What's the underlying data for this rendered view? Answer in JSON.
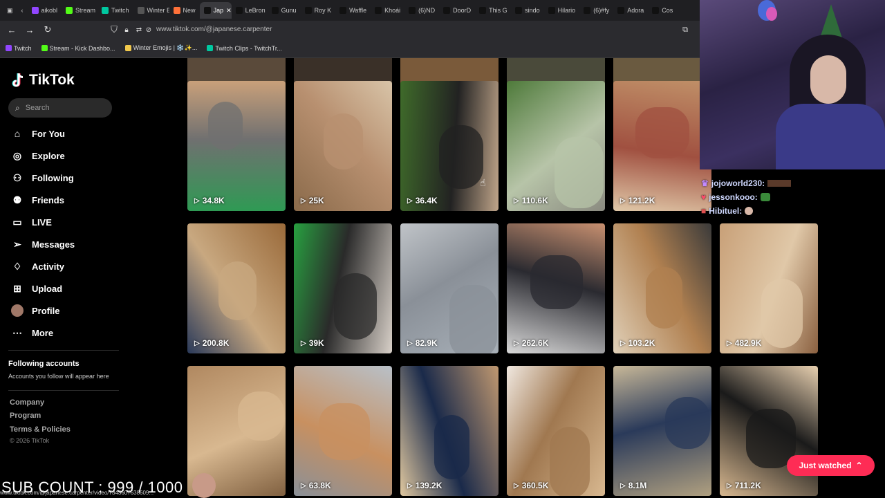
{
  "tabs": [
    {
      "label": "aikobl",
      "color": "#9146ff"
    },
    {
      "label": "Stream",
      "color": "#53fc18"
    },
    {
      "label": "Twitch",
      "color": "#00c8a0"
    },
    {
      "label": "Winter Em",
      "color": "#555"
    },
    {
      "label": "New",
      "color": "#ff7139"
    },
    {
      "label": "Jap",
      "color": "#111",
      "active": true
    },
    {
      "label": "LeBron",
      "color": "#111"
    },
    {
      "label": "Gunu",
      "color": "#111"
    },
    {
      "label": "Roy K",
      "color": "#111"
    },
    {
      "label": "Waffle",
      "color": "#111"
    },
    {
      "label": "Khoái",
      "color": "#111"
    },
    {
      "label": "(6)ND",
      "color": "#111"
    },
    {
      "label": "DoorD",
      "color": "#111"
    },
    {
      "label": "This G",
      "color": "#111"
    },
    {
      "label": "sindo",
      "color": "#111"
    },
    {
      "label": "Hilario",
      "color": "#111"
    },
    {
      "label": "(6)#fy",
      "color": "#111"
    },
    {
      "label": "Adora",
      "color": "#111"
    },
    {
      "label": "Cos",
      "color": "#111"
    }
  ],
  "address": {
    "url": "www.tiktok.com/@japanese.carpenter"
  },
  "bookmarks": [
    {
      "label": "Twitch",
      "color": "#9146ff"
    },
    {
      "label": "Stream - Kick Dashbo...",
      "color": "#53fc18"
    },
    {
      "label": "Winter Emojis | ❄️✨...",
      "color": "#f2c94c"
    },
    {
      "label": "Twitch Clips - TwitchTr...",
      "color": "#00c8a0"
    }
  ],
  "sidebar": {
    "logo": "TikTok",
    "search_placeholder": "Search",
    "items": [
      {
        "label": "For You",
        "icon": "home-icon"
      },
      {
        "label": "Explore",
        "icon": "compass-icon"
      },
      {
        "label": "Following",
        "icon": "user-plus-icon"
      },
      {
        "label": "Friends",
        "icon": "users-icon"
      },
      {
        "label": "LIVE",
        "icon": "live-icon"
      },
      {
        "label": "Messages",
        "icon": "send-icon"
      },
      {
        "label": "Activity",
        "icon": "bell-icon"
      },
      {
        "label": "Upload",
        "icon": "upload-icon"
      },
      {
        "label": "Profile",
        "icon": "avatar"
      },
      {
        "label": "More",
        "icon": "more-icon"
      }
    ],
    "following_title": "Following accounts",
    "following_sub": "Accounts you follow will appear here",
    "footer": [
      "Company",
      "Program",
      "Terms & Policies"
    ],
    "copyright": "© 2026 TikTok"
  },
  "videos": [
    {
      "views": "34.8K",
      "colors": [
        "#2f9a54",
        "#707070",
        "#c9a07a"
      ]
    },
    {
      "views": "25K",
      "colors": [
        "#8a6a4a",
        "#b89070",
        "#d8c4a8"
      ]
    },
    {
      "views": "36.4K",
      "colors": [
        "#3f6b2a",
        "#222",
        "#c0a58a"
      ]
    },
    {
      "views": "110.6K",
      "colors": [
        "#4e7a3a",
        "#b7c4a8",
        "#8a8a80"
      ]
    },
    {
      "views": "121.2K",
      "colors": [
        "#c09068",
        "#a05040",
        "#e0c8a8"
      ]
    },
    {
      "views": "200.8K",
      "colors": [
        "#9a6a3a",
        "#c8a880",
        "#2a3a5a"
      ]
    },
    {
      "views": "39K",
      "colors": [
        "#d8d0c8",
        "#2a2a2a",
        "#28a040"
      ]
    },
    {
      "views": "82.9K",
      "colors": [
        "#a8b0b8",
        "#8a9098",
        "#c0c4c8"
      ]
    },
    {
      "views": "262.6K",
      "colors": [
        "#d8d8d8",
        "#2a2a30",
        "#c89070"
      ]
    },
    {
      "views": "103.2K",
      "colors": [
        "#e0d0b8",
        "#b08050",
        "#3a3a3a"
      ]
    },
    {
      "views": "482.9K",
      "colors": [
        "#c8a078",
        "#e0c8a8",
        "#8a6040"
      ]
    },
    {
      "views": "",
      "colors": [
        "#b08860",
        "#d8b890",
        "#806040"
      ]
    },
    {
      "views": "63.8K",
      "colors": [
        "#b8c0c8",
        "#c89060",
        "#8a9098"
      ]
    },
    {
      "views": "139.2K",
      "colors": [
        "#c09870",
        "#1a2a4a",
        "#e0c8a0"
      ]
    },
    {
      "views": "360.5K",
      "colors": [
        "#d8b890",
        "#a07850",
        "#f0e8e0"
      ]
    },
    {
      "views": "8.1M",
      "colors": [
        "#b0a080",
        "#2a3a5a",
        "#c8b898"
      ]
    },
    {
      "views": "711.2K",
      "colors": [
        "#d8b890",
        "#1a1a1a",
        "#e8d0b0"
      ]
    }
  ],
  "chat": [
    {
      "user": "jojoworld230:"
    },
    {
      "user": "jessonkooo:"
    },
    {
      "user": "Hibituel:"
    }
  ],
  "overlay": {
    "sub_count": "SUB COUNT : 999 / 1000",
    "status_url": "www.tiktok.com/@japanese.carpenter/video/7343607638609..."
  },
  "just_watched": "Just watched",
  "colors": {
    "accent": "#fe2c55",
    "bg": "#000000"
  }
}
